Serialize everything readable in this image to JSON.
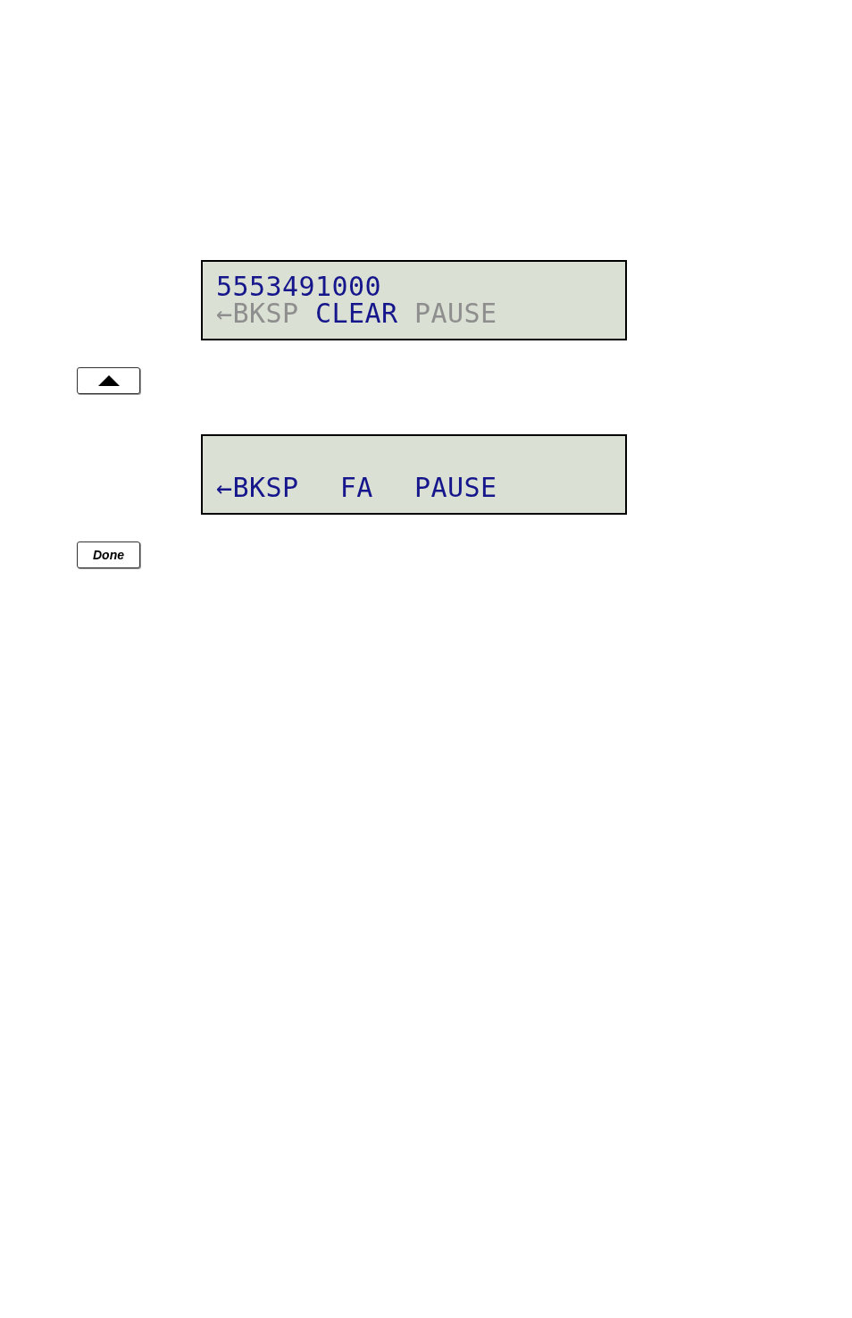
{
  "steps": [
    {
      "screen": {
        "line_1": "5553491000",
        "softkeys": [
          {
            "label": "←BKSP",
            "disabled": true
          },
          {
            "label": "CLEAR",
            "disabled": false
          },
          {
            "label": "PAUSE",
            "disabled": true
          }
        ]
      },
      "button": {
        "kind": "up_arrow"
      }
    },
    {
      "screen": {
        "softkeys": [
          {
            "label": "←BKSP",
            "disabled": false
          },
          {
            "label": "FA",
            "disabled": false
          },
          {
            "label": "PAUSE",
            "disabled": false
          }
        ]
      },
      "button": {
        "kind": "text",
        "label": "Done"
      }
    }
  ]
}
